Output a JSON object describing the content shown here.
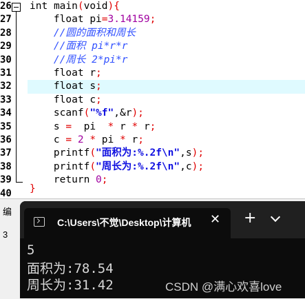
{
  "editor": {
    "line_numbers": [
      "26",
      "27",
      "28",
      "29",
      "30",
      "31",
      "32",
      "33",
      "34",
      "35",
      "36",
      "37",
      "38",
      "39",
      "40"
    ],
    "lines": [
      {
        "ret": "int",
        "name": "main",
        "po": "(",
        "arg": "void",
        "pc": ")",
        "brace": "{"
      },
      {
        "type": "float",
        "name": "pi",
        "eq": "=",
        "val": "3.14159",
        "semi": ";"
      },
      {
        "comment": "//圆的面积和周长"
      },
      {
        "comment": "//面积 pi*r*r"
      },
      {
        "comment": "//周长 2*pi*r"
      },
      {
        "type": "float",
        "name": "r",
        "semi": ";"
      },
      {
        "type": "float",
        "name": "s",
        "semi": ";"
      },
      {
        "type": "float",
        "name": "c",
        "semi": ";"
      },
      {
        "fn": "scanf",
        "po": "(",
        "fmt": "\"%f\"",
        "rest": ",&r",
        "pc": ")",
        "semi": ";"
      },
      {
        "lhs": "s",
        "eq": "=",
        "a": "pi",
        "op1": "*",
        "b": "r",
        "op2": "*",
        "c": "r",
        "semi": ";"
      },
      {
        "lhs": "c",
        "eq": "=",
        "a": "2",
        "op1": "*",
        "b": "pi",
        "op2": "*",
        "c": "r",
        "semi": ";"
      },
      {
        "fn": "printf",
        "po": "(",
        "q1": "\"",
        "label": "面积为:",
        "fmt": "%.2f\\n\"",
        "rest": ",s",
        "pc": ")",
        "semi": ";"
      },
      {
        "fn": "printf",
        "po": "(",
        "q1": "\"",
        "label": "周长为:",
        "fmt": "%.2f\\n\"",
        "rest": ",c",
        "pc": ")",
        "semi": ";"
      },
      {
        "kw": "return",
        "val": "0",
        "semi": ";"
      },
      {
        "brace": "}"
      }
    ]
  },
  "bottom_strip": {
    "label1": "编",
    "label2": "3"
  },
  "terminal": {
    "tab_title": "C:\\Users\\不觉\\Desktop\\计算机",
    "close_glyph": "✕",
    "new_tab_glyph": "+",
    "output": [
      "5",
      "面积为:78.54",
      "周长为:31.42"
    ],
    "background": "#0c0c0c"
  },
  "watermark": "CSDN @满心欢喜love"
}
